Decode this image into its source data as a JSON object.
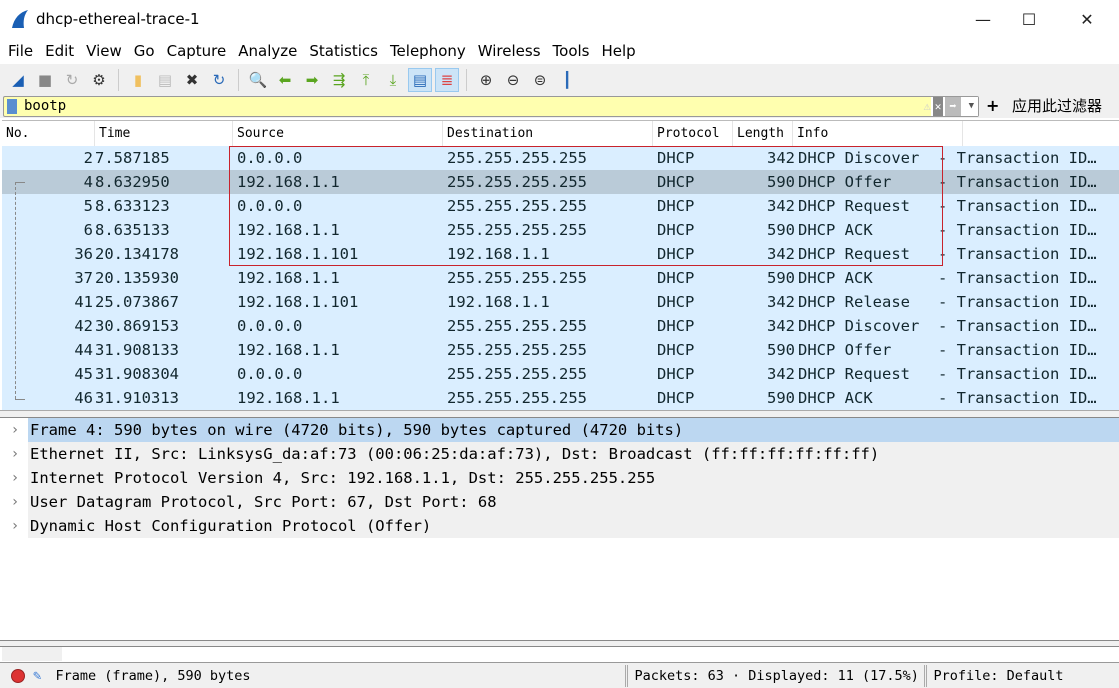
{
  "window": {
    "title": "dhcp-ethereal-trace-1",
    "minimize": "—",
    "maximize": "☐",
    "close": "✕"
  },
  "menu": [
    "File",
    "Edit",
    "View",
    "Go",
    "Capture",
    "Analyze",
    "Statistics",
    "Telephony",
    "Wireless",
    "Tools",
    "Help"
  ],
  "toolbar": [
    "shark-fin-icon",
    "stop-icon",
    "restart-icon",
    "options-gear-icon",
    "open-folder-icon",
    "file-icon",
    "close-file-icon",
    "reload-icon",
    "find-icon",
    "back-arrow-icon",
    "forward-arrow-icon",
    "go-to-packet-icon",
    "first-packet-icon",
    "last-packet-icon",
    "autoscroll-icon",
    "colorize-icon",
    "zoom-in-icon",
    "zoom-out-icon",
    "zoom-normal-icon",
    "resize-columns-icon"
  ],
  "filter": {
    "value": "bootp",
    "apply_label": "应用此过滤器",
    "plus": "+",
    "bg_color": "#ffffaf"
  },
  "columns": [
    "No.",
    "Time",
    "Source",
    "Destination",
    "Protocol",
    "Length",
    "Info"
  ],
  "packets": [
    {
      "no": "2",
      "time": "7.587185",
      "src": "0.0.0.0",
      "dst": "255.255.255.255",
      "proto": "DHCP",
      "len": "342",
      "info": "DHCP Discover  - Transaction ID…"
    },
    {
      "no": "4",
      "time": "8.632950",
      "src": "192.168.1.1",
      "dst": "255.255.255.255",
      "proto": "DHCP",
      "len": "590",
      "info": "DHCP Offer     - Transaction ID…",
      "selected": true
    },
    {
      "no": "5",
      "time": "8.633123",
      "src": "0.0.0.0",
      "dst": "255.255.255.255",
      "proto": "DHCP",
      "len": "342",
      "info": "DHCP Request   - Transaction ID…"
    },
    {
      "no": "6",
      "time": "8.635133",
      "src": "192.168.1.1",
      "dst": "255.255.255.255",
      "proto": "DHCP",
      "len": "590",
      "info": "DHCP ACK       - Transaction ID…"
    },
    {
      "no": "36",
      "time": "20.134178",
      "src": "192.168.1.101",
      "dst": "192.168.1.1",
      "proto": "DHCP",
      "len": "342",
      "info": "DHCP Request   - Transaction ID…"
    },
    {
      "no": "37",
      "time": "20.135930",
      "src": "192.168.1.1",
      "dst": "255.255.255.255",
      "proto": "DHCP",
      "len": "590",
      "info": "DHCP ACK       - Transaction ID…"
    },
    {
      "no": "41",
      "time": "25.073867",
      "src": "192.168.1.101",
      "dst": "192.168.1.1",
      "proto": "DHCP",
      "len": "342",
      "info": "DHCP Release   - Transaction ID…"
    },
    {
      "no": "42",
      "time": "30.869153",
      "src": "0.0.0.0",
      "dst": "255.255.255.255",
      "proto": "DHCP",
      "len": "342",
      "info": "DHCP Discover  - Transaction ID…"
    },
    {
      "no": "44",
      "time": "31.908133",
      "src": "192.168.1.1",
      "dst": "255.255.255.255",
      "proto": "DHCP",
      "len": "590",
      "info": "DHCP Offer     - Transaction ID…"
    },
    {
      "no": "45",
      "time": "31.908304",
      "src": "0.0.0.0",
      "dst": "255.255.255.255",
      "proto": "DHCP",
      "len": "342",
      "info": "DHCP Request   - Transaction ID…"
    },
    {
      "no": "46",
      "time": "31.910313",
      "src": "192.168.1.1",
      "dst": "255.255.255.255",
      "proto": "DHCP",
      "len": "590",
      "info": "DHCP ACK       - Transaction ID…"
    }
  ],
  "details": [
    "Frame 4: 590 bytes on wire (4720 bits), 590 bytes captured (4720 bits)",
    "Ethernet II, Src: LinksysG_da:af:73 (00:06:25:da:af:73), Dst: Broadcast (ff:ff:ff:ff:ff:ff)",
    "Internet Protocol Version 4, Src: 192.168.1.1, Dst: 255.255.255.255",
    "User Datagram Protocol, Src Port: 67, Dst Port: 68",
    "Dynamic Host Configuration Protocol (Offer)"
  ],
  "status": {
    "left": "Frame (frame), 590 bytes",
    "packets": "Packets: 63 · Displayed: 11 (17.5%)",
    "profile": "Profile: Default"
  },
  "colors": {
    "row_bg": "#daeeff",
    "selected_row": "#bacbd8",
    "highlight_box": "#c8232c"
  }
}
